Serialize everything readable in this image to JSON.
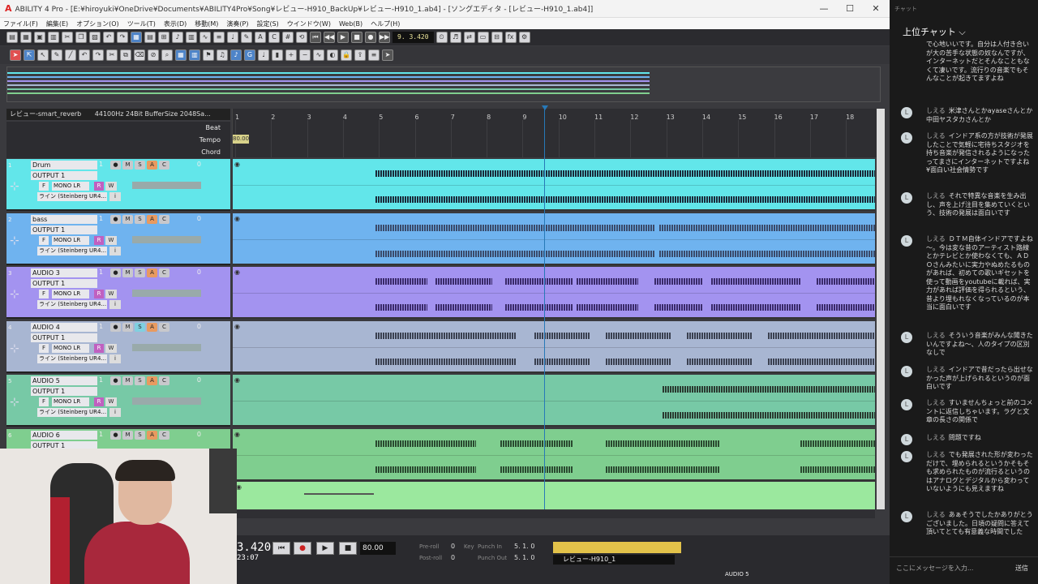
{
  "window": {
    "title": "ABILITY 4 Pro - [E:¥hiroyuki¥OneDrive¥Documents¥ABILITY4Pro¥Song¥レビュー-H910_BackUp¥レビュー-H910_1.ab4] - [ソングエディタ - [レビュー-H910_1.ab4]]",
    "minimize": "—",
    "maximize": "☐",
    "close": "✕"
  },
  "menu": [
    "ファイル(F)",
    "編集(E)",
    "オプション(O)",
    "ツール(T)",
    "表示(D)",
    "移動(M)",
    "演奏(P)",
    "設定(S)",
    "ウインドウ(W)",
    "Web(B)",
    "ヘルプ(H)"
  ],
  "toolbar": {
    "position_display": "9. 3.420"
  },
  "song_info": {
    "name": "レビュー-smart_reverb",
    "audio": "44100Hz 24Bit BufferSize 2048Sa..."
  },
  "ruler": {
    "rows": [
      "Beat",
      "Tempo",
      "Chord"
    ],
    "bars": [
      "1",
      "2",
      "3",
      "4",
      "5",
      "6",
      "7",
      "8",
      "9",
      "10",
      "11",
      "12",
      "13",
      "14",
      "15",
      "16",
      "17",
      "18"
    ],
    "tempo_value": "80.00"
  },
  "tracks": [
    {
      "num": "1",
      "name": "Drum",
      "output": "OUTPUT 1",
      "ch": "1",
      "vol": "0",
      "mono": "MONO LR",
      "input": "ライン (Steinberg UR4...",
      "color": "#62e6ea"
    },
    {
      "num": "2",
      "name": "bass",
      "output": "OUTPUT 1",
      "ch": "1",
      "vol": "0",
      "mono": "MONO LR",
      "input": "ライン (Steinberg UR4...",
      "color": "#6fb3ef"
    },
    {
      "num": "3",
      "name": "AUDIO 3",
      "output": "OUTPUT 1",
      "ch": "1",
      "vol": "0",
      "mono": "MONO LR",
      "input": "ライン (Steinberg UR4...",
      "color": "#a393f0"
    },
    {
      "num": "4",
      "name": "AUDIO 4",
      "output": "OUTPUT 1",
      "ch": "1",
      "vol": "0",
      "mono": "MONO LR",
      "input": "ライン (Steinberg UR4...",
      "color": "#a8b6d2"
    },
    {
      "num": "5",
      "name": "AUDIO 5",
      "output": "OUTPUT 1",
      "ch": "1",
      "vol": "0",
      "mono": "MONO LR",
      "input": "ライン (Steinberg UR4...",
      "color": "#77c9a6"
    },
    {
      "num": "6",
      "name": "AUDIO 6",
      "output": "OUTPUT 1",
      "ch": "1",
      "vol": "0",
      "mono": "MONO LR",
      "input": "ライン (Steinberg UR4...",
      "color": "#7fce8f"
    }
  ],
  "track_buttons": {
    "m": "M",
    "s": "S",
    "a": "A",
    "c": "C",
    "f": "F",
    "r": "R",
    "w": "W",
    "info": "i"
  },
  "transport": {
    "time_big": "3.420",
    "time_small": "23:07",
    "tempo": "80.00",
    "preroll_label": "Pre-roll",
    "preroll": "0",
    "postroll_label": "Post-roll",
    "postroll": "0",
    "key_label": "Key",
    "punch_in_label": "Punch In",
    "punch_in": "5. 1. 0",
    "punch_out_label": "Punch Out",
    "punch_out": "5. 1. 0",
    "song_name": "レビュー-H910_1",
    "track_label": "AUDIO 5"
  },
  "chat": {
    "tab": "チャット",
    "header": "上位チャット",
    "first_text": "で心地いいです。自分は人付き合いが大の苦手な状態の奴なんですが、インターネットだとそんなこともなくて凄いです。流行りの音楽でもそんなことが起きてますよね",
    "messages": [
      {
        "user": "しえる",
        "text": "米津さんとかayaseさんとか中田ヤスタカさんとか"
      },
      {
        "user": "しえる",
        "text": "インドア系の方が技術が発展したことで気軽に宅待ちスタジオを持ち音楽が発信されるようになったってまさにインターネットですよね¥面白い社会情勢です"
      },
      {
        "user": "しえる",
        "text": "それで特異な音楽を生み出し、声を上げ注目を集めていくという、技術の発展は面白いです"
      },
      {
        "user": "しえる",
        "text": "ＤＴＭ自体インドアですよね～。今は変な昔のアーティスト路線とかテレビとか使わなくても、ＡＤＯさんみたいに実力やぬめたるものがあれば、初めての歌いギセットを使って動画をyoutubeに載れば、実力があれば評価を得られるという、昔より埋もれなくなっているのが本当に面白いです"
      },
      {
        "user": "しえる",
        "text": "そういう音楽がみんな聞きたいんですよね～、人のタイプの区別なしで"
      },
      {
        "user": "しえる",
        "text": "インドアで昔だったら出せなかった声が上げられるというのが面白いです"
      },
      {
        "user": "しえる",
        "text": "すいませんちょっと前のコメントに返信しちゃいます。ラグと文章の長さの関係で"
      },
      {
        "user": "しえる",
        "text": "問題ですね"
      },
      {
        "user": "しえる",
        "text": "でも発展された形が変わっただけで、埋められるというかそもそも求められたものが流行るというのはアナログとデジタルから変わっていないようにも見えますね"
      },
      {
        "user": "しえる",
        "text": "あぁそうでしたかありがとうございました。日頃の疑問に答えて頂いてとても有意義な時間でした"
      }
    ],
    "input_placeholder": "ここにメッセージを入力...",
    "send_label": "送信"
  }
}
